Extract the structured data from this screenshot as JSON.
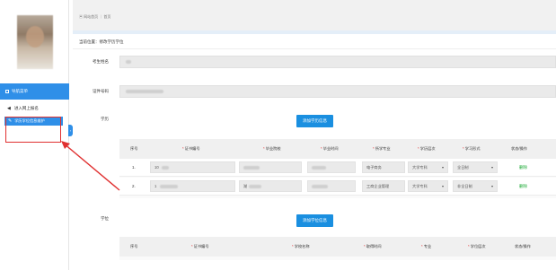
{
  "sidebar": {
    "nav_title": "导航菜单",
    "items": [
      {
        "label": "进入网上报名",
        "icon": "◀"
      },
      {
        "label": "学历学位信息维护",
        "icon": "✎"
      }
    ],
    "collapse_icon": "‹"
  },
  "topbar": {
    "tab_text": "▣ 网站首页 ｜ 首页"
  },
  "main": {
    "breadcrumb": "当前位置：修改学历学位",
    "labels": {
      "name": "考生姓名",
      "id_no": "证件号码",
      "degree_section": "学历",
      "degree_section2": "学位"
    },
    "add_degree_button": "添加学历信息",
    "add_degree_button2": "添加学位信息",
    "table1": {
      "headers": [
        {
          "text": "序号",
          "req": false
        },
        {
          "text": "证书编号",
          "req": true
        },
        {
          "text": "毕业院校",
          "req": true
        },
        {
          "text": "毕业时间",
          "req": true
        },
        {
          "text": "所学专业",
          "req": true
        },
        {
          "text": "学历层次",
          "req": true
        },
        {
          "text": "学习形式",
          "req": true
        },
        {
          "text": "状态/操作",
          "req": false
        }
      ],
      "rows": [
        {
          "idx": "1.",
          "cert": "10",
          "major": "电子商务",
          "level": "大学专科",
          "form": "全日制",
          "op": "删除"
        },
        {
          "idx": "2.",
          "cert": "1",
          "school": "湖",
          "major": "工商企业管理",
          "level": "大学专科",
          "form": "非全日制",
          "op": "删除"
        }
      ]
    },
    "table2": {
      "headers": [
        {
          "text": "序号",
          "req": false
        },
        {
          "text": "证书编号",
          "req": true
        },
        {
          "text": "学校名称",
          "req": true
        },
        {
          "text": "取得时间",
          "req": true
        },
        {
          "text": "专业",
          "req": true
        },
        {
          "text": "学位层次",
          "req": true
        },
        {
          "text": "状态/操作",
          "req": false
        }
      ]
    }
  },
  "colors": {
    "accent": "#2f8fe8",
    "button": "#1a8fe0",
    "delete": "#18a832",
    "annotation": "#e03030"
  }
}
